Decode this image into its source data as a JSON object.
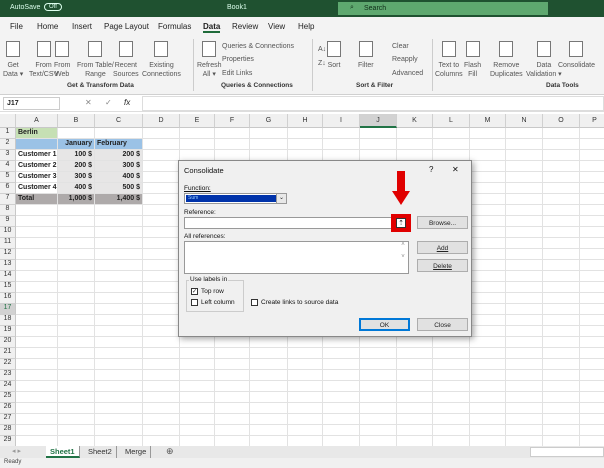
{
  "titlebar": {
    "autosave": "AutoSave",
    "autosave_state": "Off",
    "title": "Book1",
    "search": "Search"
  },
  "menu": [
    "File",
    "Home",
    "Insert",
    "Page Layout",
    "Formulas",
    "Data",
    "Review",
    "View",
    "Help"
  ],
  "active_menu": "Data",
  "ribbon": {
    "big": [
      [
        "Get",
        "Data ▾"
      ],
      [
        "From",
        "Text/CSV"
      ],
      [
        "From",
        "Web"
      ],
      [
        "From Table/",
        "Range"
      ],
      [
        "Recent",
        "Sources"
      ],
      [
        "Existing",
        "Connections"
      ],
      [
        "Refresh",
        "All ▾"
      ],
      [
        "Sort",
        ""
      ],
      [
        "Filter",
        ""
      ],
      [
        "Text to",
        "Columns"
      ],
      [
        "Flash",
        "Fill"
      ],
      [
        "Remove",
        "Duplicates"
      ],
      [
        "Data",
        "Validation ▾"
      ],
      [
        "Consolidate",
        ""
      ]
    ],
    "small": [
      "Queries & Connections",
      "Properties",
      "Edit Links",
      "Clear",
      "Reapply",
      "Advanced"
    ],
    "groups": [
      "Get & Transform Data",
      "Queries & Connections",
      "Sort & Filter",
      "Data Tools"
    ]
  },
  "formula": {
    "namebox": "J17",
    "fx": "fx",
    "cancel": "✕",
    "enter": "✓"
  },
  "columns": [
    "A",
    "B",
    "C",
    "D",
    "E",
    "F",
    "G",
    "H",
    "I",
    "J",
    "K",
    "L",
    "M",
    "N",
    "O",
    "P"
  ],
  "rows": 29,
  "selected_cell": "J17",
  "cells": [
    {
      "ref": "A1",
      "v": "Berlin",
      "bold": true,
      "bg": "#c6e0b4"
    },
    {
      "ref": "A2",
      "v": "",
      "bg": "#9bc2e6"
    },
    {
      "ref": "B2",
      "v": "January",
      "bold": true,
      "bg": "#9bc2e6",
      "align": "right"
    },
    {
      "ref": "C2",
      "v": "February",
      "bold": true,
      "bg": "#9bc2e6",
      "align": "left"
    },
    {
      "ref": "A3",
      "v": "Customer 1",
      "bold": true
    },
    {
      "ref": "B3",
      "v": "100 $",
      "bold": true,
      "bg": "#e7e6e6",
      "align": "right"
    },
    {
      "ref": "C3",
      "v": "200 $",
      "bold": true,
      "bg": "#e7e6e6",
      "align": "right"
    },
    {
      "ref": "A4",
      "v": "Customer 2",
      "bold": true
    },
    {
      "ref": "B4",
      "v": "200 $",
      "bold": true,
      "bg": "#e7e6e6",
      "align": "right"
    },
    {
      "ref": "C4",
      "v": "300 $",
      "bold": true,
      "bg": "#e7e6e6",
      "align": "right"
    },
    {
      "ref": "A5",
      "v": "Customer 3",
      "bold": true
    },
    {
      "ref": "B5",
      "v": "300 $",
      "bold": true,
      "bg": "#e7e6e6",
      "align": "right"
    },
    {
      "ref": "C5",
      "v": "400 $",
      "bold": true,
      "bg": "#e7e6e6",
      "align": "right"
    },
    {
      "ref": "A6",
      "v": "Customer 4",
      "bold": true
    },
    {
      "ref": "B6",
      "v": "400 $",
      "bold": true,
      "bg": "#e7e6e6",
      "align": "right"
    },
    {
      "ref": "C6",
      "v": "500 $",
      "bold": true,
      "bg": "#e7e6e6",
      "align": "right"
    },
    {
      "ref": "A7",
      "v": "Total",
      "bold": true,
      "bg": "#aeaaaa"
    },
    {
      "ref": "B7",
      "v": "1,000 $",
      "bold": true,
      "bg": "#aeaaaa",
      "align": "right"
    },
    {
      "ref": "C7",
      "v": "1,400 $",
      "bold": true,
      "bg": "#aeaaaa",
      "align": "right"
    }
  ],
  "sheets": [
    "Sheet1",
    "Sheet2",
    "Merge"
  ],
  "active_sheet": "Sheet1",
  "status": "Ready",
  "dialog": {
    "title": "Consolidate",
    "help": "?",
    "close": "✕",
    "function_label": "Function:",
    "function_value": "Sum",
    "reference_label": "Reference:",
    "reference_value": "",
    "all_refs_label": "All references:",
    "browse": "Browse...",
    "add": "Add",
    "delete": "Delete",
    "use_labels": "Use labels in",
    "top_row": "Top row",
    "top_row_checked": true,
    "left_column": "Left column",
    "left_column_checked": false,
    "create_links": "Create links to source data",
    "create_links_checked": false,
    "ok": "OK",
    "close_btn": "Close"
  },
  "colors": {
    "accent": "#217346",
    "highlight": "#e00000"
  }
}
